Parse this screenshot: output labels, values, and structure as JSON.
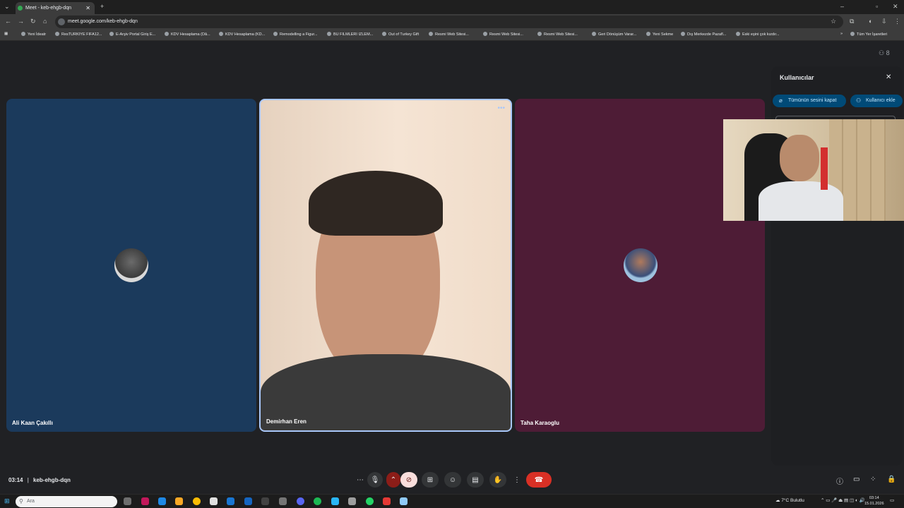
{
  "browser": {
    "tab_title": "Meet - keb-ehgb-dqn",
    "url": "meet.google.com/keb-ehgb-dqn",
    "bookmarks": [
      "Yeni İdeatr",
      "ResTURKIYE FIFA12...",
      "E-Arşiv Portal Giriş E...",
      "KDV Hesaplama (Dâ...",
      "KDV Hesaplama (KD...",
      "Remodelling a Figur...",
      "BU FILMLERI IZLEM...",
      "Out of Turkey Gift",
      "Resmi Web Sitesi...",
      "Resmi Web Sitesi...",
      "Resmi Web Sitesi...",
      "Geri Dönüşüm Varar...",
      "Yeni Sekme",
      "Dış Merkezde Pazafl...",
      "Eski eşini çok kızdır..."
    ],
    "bookmarks_other": "Tüm Yer İşaretleri"
  },
  "meet": {
    "tiles": [
      {
        "name": "Ali Kaan Çakıllı",
        "bg": "#1b3a5c"
      },
      {
        "name": "Demirhan Eren"
      },
      {
        "name": "Taha Karaoglu",
        "bg": "#4e1c36"
      }
    ],
    "time": "03:14",
    "separator": "|",
    "meeting_code": "keb-ehgb-dqn",
    "participant_count": "8"
  },
  "people_panel": {
    "title": "Kullanıcılar",
    "mute_all_label": "Tümünün sesini kapat",
    "add_people_label": "Kullanıcı ekle"
  },
  "taskbar": {
    "search_placeholder": "Ara",
    "weather": "7°C Bulutlu",
    "time": "03:14",
    "date": "15.01.2026"
  },
  "colors": {
    "end_call": "#d93025",
    "camera_off": "#f9dedc",
    "panel_button": "#004a77",
    "active_tile_border": "#a8c7fa"
  }
}
